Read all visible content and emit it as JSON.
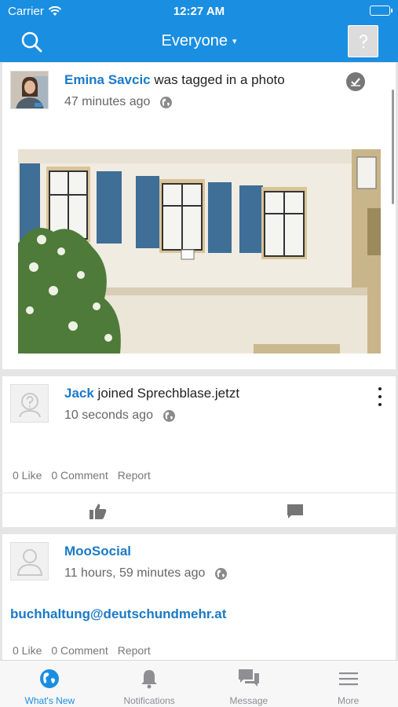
{
  "status_bar": {
    "carrier": "Carrier",
    "time": "12:27 AM"
  },
  "nav": {
    "title": "Everyone",
    "caret": "▾"
  },
  "feed": [
    {
      "user": "Emina Savcic",
      "action": " was tagged in a photo",
      "time": "47 minutes ago"
    },
    {
      "user": "Jack",
      "action": " joined Sprechblase.jetzt",
      "time": "10 seconds ago",
      "stats": {
        "likes": "0 Like",
        "comments": "0 Comment",
        "report": "Report"
      }
    },
    {
      "user": "MooSocial",
      "action": "",
      "time": "11 hours, 59 minutes ago",
      "link": "buchhaltung@deutschundmehr.at",
      "stats": {
        "likes": "0 Like",
        "comments": "0 Comment",
        "report": "Report"
      }
    }
  ],
  "tabs": [
    {
      "label": "What's New",
      "icon": "globe-icon",
      "active": true
    },
    {
      "label": "Notifications",
      "icon": "bell-icon",
      "active": false
    },
    {
      "label": "Message",
      "icon": "chat-bubbles-icon",
      "active": false
    },
    {
      "label": "More",
      "icon": "menu-icon",
      "active": false
    }
  ],
  "colors": {
    "brand": "#1a8ee1",
    "link": "#1a7ac8",
    "inactive": "#8e8e93"
  }
}
